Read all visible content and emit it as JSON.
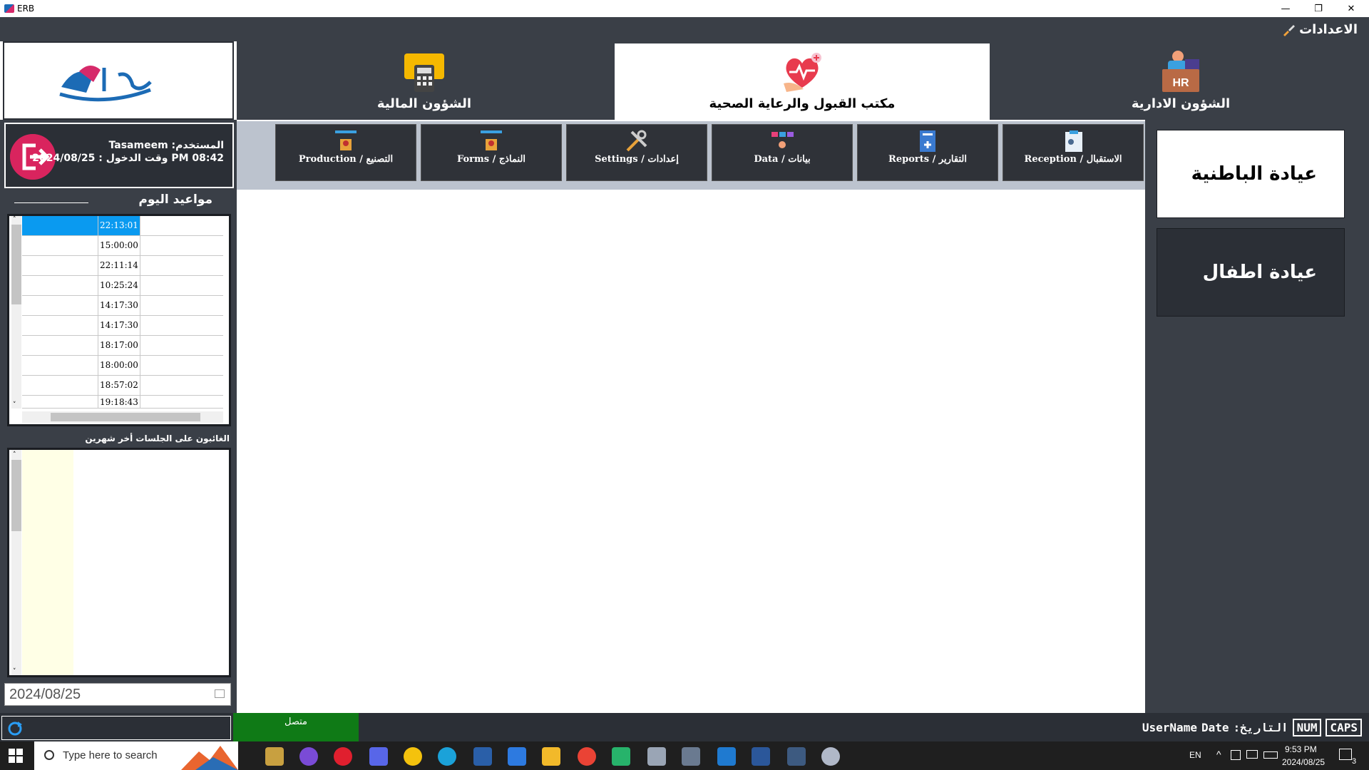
{
  "window": {
    "title": "ERB",
    "minimize": "—",
    "restore": "❐",
    "close": "✕"
  },
  "menubar": {
    "settings_label": "الاعدادات"
  },
  "topnav": [
    {
      "label": "الشؤون المالية",
      "active": false
    },
    {
      "label": "مكتب القبول والرعاية الصحية",
      "active": true
    },
    {
      "label": "الشؤون الادارية",
      "active": false
    }
  ],
  "hr_icon_text": "HR",
  "logo_text": "تصاميم",
  "user": {
    "name_line": "Tasameem :المستخدم",
    "login_line": "وقت الدخول : 2024/08/25 PM 08:42"
  },
  "appointments": {
    "title": "مواعيد اليوم",
    "times": [
      "22:13:01",
      "15:00:00",
      "22:11:14",
      "10:25:24",
      "14:17:30",
      "14:17:30",
      "18:17:00",
      "18:00:00",
      "18:57:02",
      "19:18:43"
    ]
  },
  "absent": {
    "title": "الغائبون على الجلسات أخر شهرين"
  },
  "date_picker": {
    "value": "2024/08/25"
  },
  "ribbon": [
    {
      "label": "Production / التصنيع",
      "icon": "production-icon"
    },
    {
      "label": "Forms / النماذج",
      "icon": "forms-icon"
    },
    {
      "label": "Settings / إعدادات",
      "icon": "tools-icon"
    },
    {
      "label": "Data / بيانات",
      "icon": "data-icon"
    },
    {
      "label": "Reports / التقارير",
      "icon": "reports-icon"
    },
    {
      "label": "Reception / الاستقبال",
      "icon": "reception-icon"
    }
  ],
  "clinics": [
    "عيادة الباطنية",
    "عيادة اطفال"
  ],
  "statusbar": {
    "connection": "متصل",
    "username": "UserName",
    "date_label": "Date",
    "date_ar": ":التاريخ",
    "num": "NUM",
    "caps": "CAPS"
  },
  "taskbar": {
    "search_placeholder": "Type here to search",
    "lang": "EN",
    "time": "9:53 PM",
    "date": "2024/08/25",
    "notif_count": "3"
  },
  "colors": {
    "panel": "#3a3f47",
    "dark": "#2b2f36",
    "selected": "#0a9af0",
    "online": "#0f7a16",
    "logout": "#d9245e"
  }
}
